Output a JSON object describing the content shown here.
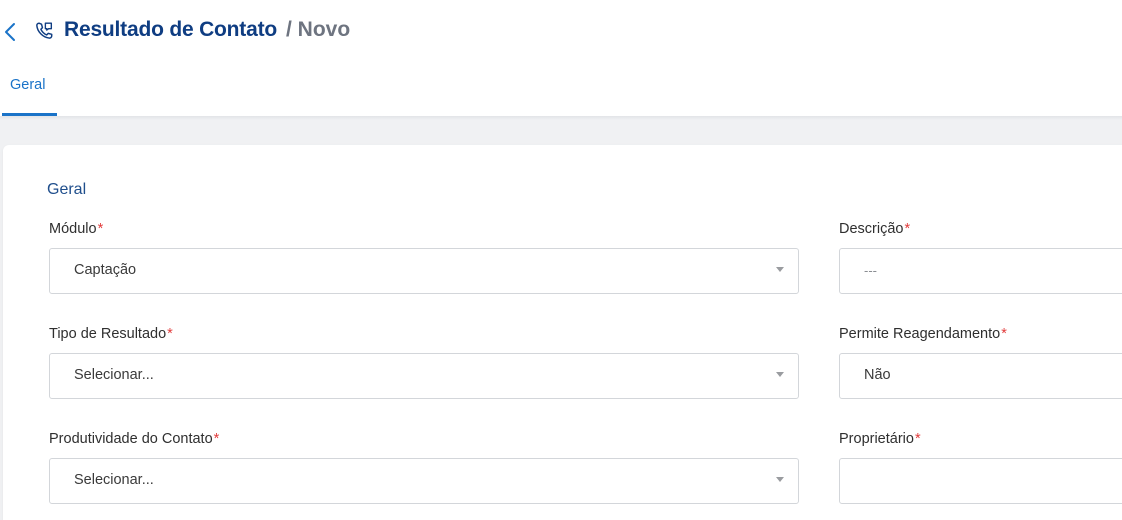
{
  "header": {
    "title": "Resultado de Contato",
    "subtitle": "/ Novo",
    "back_icon": "chevron-left-icon",
    "title_icon": "phone-callback-icon"
  },
  "tabs": [
    {
      "label": "Geral",
      "active": true
    }
  ],
  "section": {
    "title": "Geral"
  },
  "form": {
    "modulo": {
      "label": "Módulo",
      "required": "*",
      "value": "Captação"
    },
    "descricao": {
      "label": "Descrição",
      "required": "*",
      "placeholder": "---"
    },
    "tipo_resultado": {
      "label": "Tipo de Resultado",
      "required": "*",
      "value": "Selecionar..."
    },
    "permite_reagendamento": {
      "label": "Permite Reagendamento",
      "required": "*",
      "value": "Não"
    },
    "produtividade": {
      "label": "Produtividade do Contato",
      "required": "*",
      "value": "Selecionar..."
    },
    "proprietario": {
      "label": "Proprietário",
      "required": "*",
      "value": ""
    }
  },
  "colors": {
    "accent": "#1a73c8",
    "title": "#0f3d82",
    "required": "#e23b3b",
    "background": "#f0f1f3"
  }
}
